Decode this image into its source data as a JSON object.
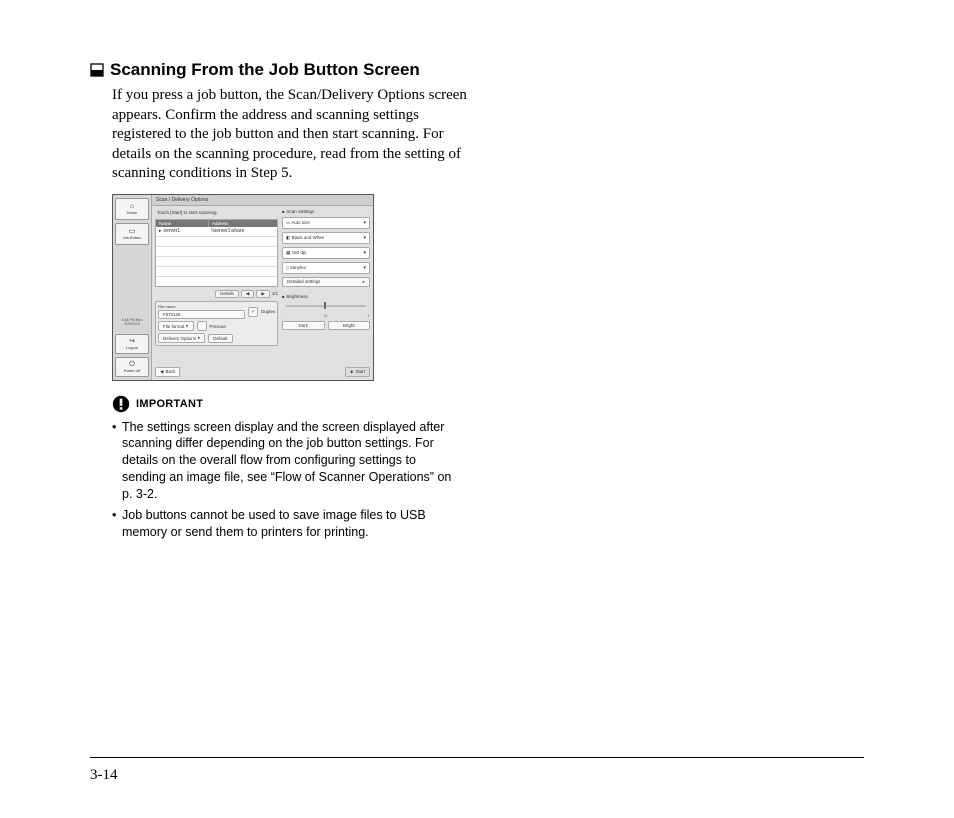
{
  "heading": "Scanning From the Job Button Screen",
  "intro": "If you press a job button, the Scan/Delivery Options screen appears. Confirm the address and scanning settings registered to the job button and then start scanning. For details on the scanning procedure, read from the setting of scanning conditions in Step 5.",
  "important_label": "IMPORTANT",
  "important_items": [
    "The settings screen display and the screen displayed after scanning differ depending on the job button settings. For details on the overall flow from configuring settings to sending an image file, see “Flow of Scanner Operations” on p. 3-2.",
    "Job buttons cannot be used to save image files to USB memory or send them to printers for printing."
  ],
  "page_number": "3-14",
  "ui": {
    "title": "Scan / Delivery Options",
    "hint": "Touch [Start] to start scanning.",
    "left": {
      "home": "Home",
      "job": "Job Button",
      "timestamp": "4:44 PM  Mon\n3/29/2010",
      "logout": "Logout",
      "poweroff": "Power off"
    },
    "addr_header": {
      "name": "Name",
      "address": "Address"
    },
    "addr_rows": [
      {
        "name": "server1",
        "address": "\\\\server1\\share"
      }
    ],
    "pager": {
      "details": "Details",
      "page": "1/1"
    },
    "filename_label": "File name",
    "filename_value": "F071126",
    "duplex_label": "Duplex",
    "prescan_label": "Prescan",
    "fileformat_btn": "File format",
    "delivery_btn": "Delivery Options",
    "default_btn": "Default",
    "scan_settings_label": "Scan Settings",
    "dropdowns": [
      "Auto size",
      "Black and White",
      "150 dpi",
      "Simplex"
    ],
    "detailed_btn": "Detailed settings",
    "brightness_label": "Brightness",
    "dark": "Dark",
    "bright": "Bright",
    "back": "Back",
    "start": "Start"
  }
}
